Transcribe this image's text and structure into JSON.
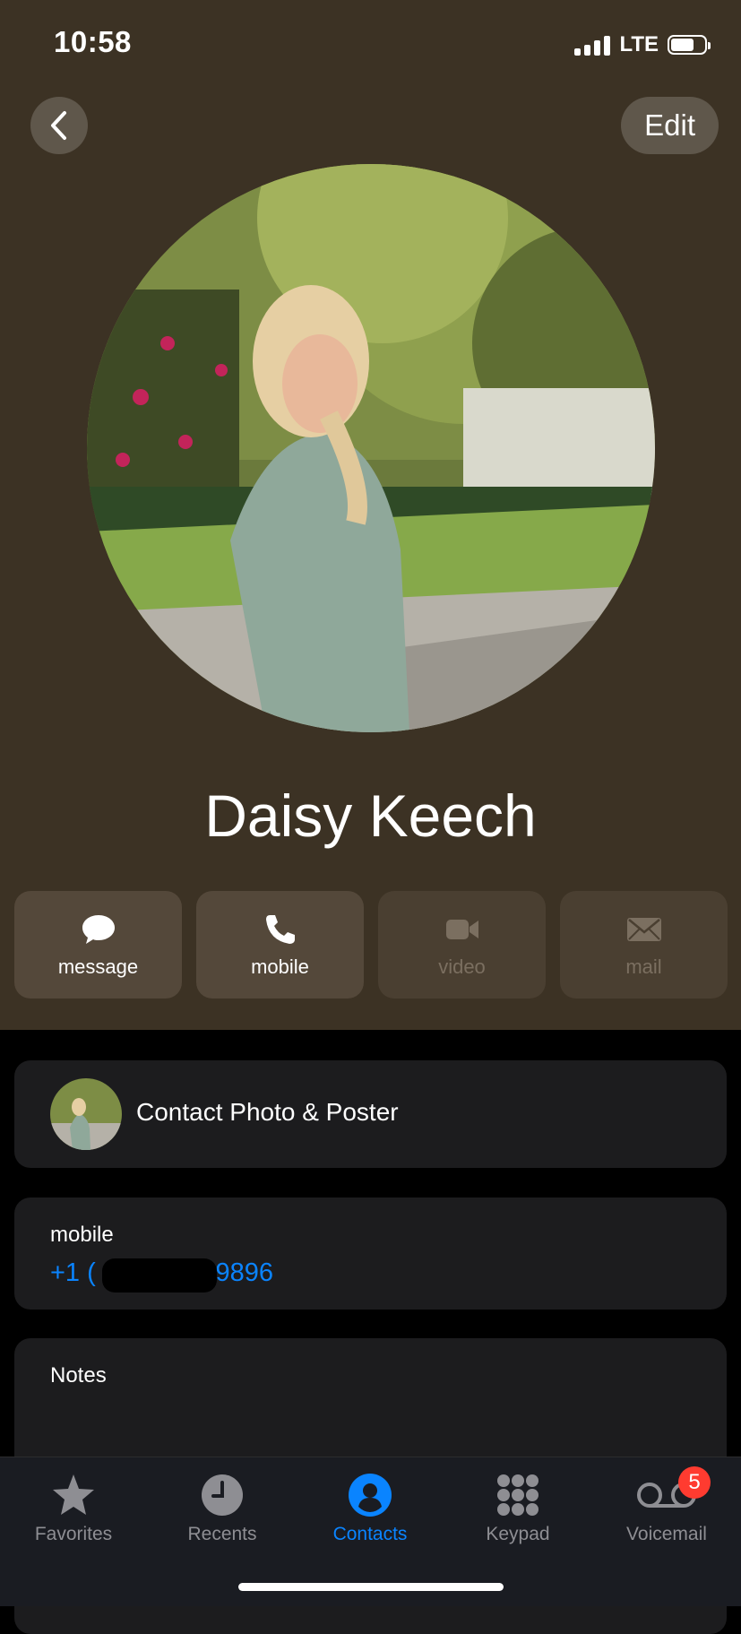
{
  "status_bar": {
    "time": "10:58",
    "network": "LTE"
  },
  "header": {
    "edit_label": "Edit"
  },
  "contact": {
    "name": "Daisy Keech"
  },
  "actions": [
    {
      "label": "message",
      "icon": "message-bubble-icon",
      "enabled": true
    },
    {
      "label": "mobile",
      "icon": "phone-icon",
      "enabled": true
    },
    {
      "label": "video",
      "icon": "video-icon",
      "enabled": false
    },
    {
      "label": "mail",
      "icon": "envelope-icon",
      "enabled": false
    }
  ],
  "poster": {
    "label": "Contact Photo & Poster"
  },
  "phone": {
    "type": "mobile",
    "number_prefix": "+1 (",
    "number_suffix": "-9896"
  },
  "notes": {
    "label": "Notes"
  },
  "tabs": [
    {
      "label": "Favorites",
      "icon": "star-icon",
      "active": false
    },
    {
      "label": "Recents",
      "icon": "clock-icon",
      "active": false
    },
    {
      "label": "Contacts",
      "icon": "person-circle-icon",
      "active": true
    },
    {
      "label": "Keypad",
      "icon": "keypad-icon",
      "active": false
    },
    {
      "label": "Voicemail",
      "icon": "voicemail-icon",
      "active": false,
      "badge": "5"
    }
  ],
  "colors": {
    "header_bg": "#3c3224",
    "accent": "#0a84ff",
    "badge": "#ff3b30"
  }
}
